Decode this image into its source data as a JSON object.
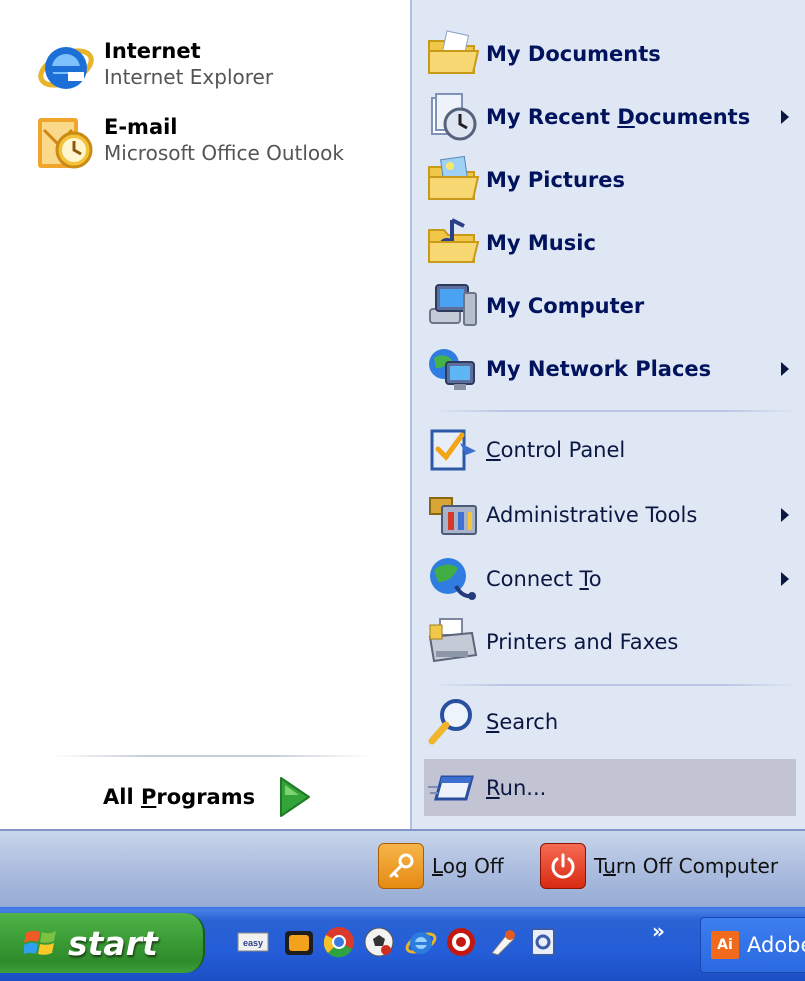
{
  "left_pane": {
    "pinned": [
      {
        "title": "Internet",
        "subtitle": "Internet Explorer",
        "icon": "internet-explorer-icon"
      },
      {
        "title": "E-mail",
        "subtitle": "Microsoft Office Outlook",
        "icon": "outlook-icon"
      }
    ],
    "all_programs": {
      "label_pre": "All ",
      "label_accel": "P",
      "label_post": "rograms",
      "icon": "green-arrow-icon"
    }
  },
  "right_pane": {
    "items": [
      {
        "label": "My Documents",
        "icon": "folder-documents-icon",
        "submenu": false
      },
      {
        "label_pre": "My Recent ",
        "label_accel": "D",
        "label_post": "ocuments",
        "icon": "recent-documents-icon",
        "submenu": true
      },
      {
        "label": "My Pictures",
        "icon": "folder-pictures-icon",
        "submenu": false
      },
      {
        "label": "My Music",
        "icon": "folder-music-icon",
        "submenu": false
      },
      {
        "label": "My Computer",
        "icon": "computer-icon",
        "submenu": false
      },
      {
        "label": "My Network Places",
        "icon": "network-places-icon",
        "submenu": true
      },
      {
        "label_pre": "",
        "label_accel": "C",
        "label_post": "ontrol Panel",
        "icon": "control-panel-icon",
        "submenu": false
      },
      {
        "label": "Administrative Tools",
        "icon": "administrative-tools-icon",
        "submenu": true
      },
      {
        "label_pre": "Connect ",
        "label_accel": "T",
        "label_post": "o",
        "icon": "connect-to-icon",
        "submenu": true
      },
      {
        "label": "Printers and Faxes",
        "icon": "printer-icon",
        "submenu": false
      },
      {
        "label_pre": "",
        "label_accel": "S",
        "label_post": "earch",
        "icon": "search-icon",
        "submenu": false
      },
      {
        "label_pre": "",
        "label_accel": "R",
        "label_post": "un...",
        "icon": "run-icon",
        "submenu": false,
        "highlighted": true
      }
    ]
  },
  "bottom_band": {
    "log_off": {
      "label_pre": "",
      "label_accel": "L",
      "label_post": "og Off",
      "icon": "key-icon"
    },
    "turn_off": {
      "label_pre": "T",
      "label_accel": "u",
      "label_post": "rn Off Computer",
      "icon": "power-icon"
    }
  },
  "taskbar": {
    "start_label": "start",
    "quick_launch": [
      "easy-icon",
      "toolbox-icon",
      "chrome-icon",
      "soccer-ball-icon",
      "ie-icon",
      "red-circle-icon",
      "media-icon",
      "scanner-icon"
    ],
    "overflow": "»",
    "app_button": {
      "badge": "Ai",
      "label": "Adobe"
    }
  },
  "colors": {
    "right_pane_bg": "#dfe7f5",
    "right_label": "#00135c",
    "taskbar_blue": "#245dd8",
    "start_green": "#3c9f37",
    "highlight": "#c2c4d4"
  }
}
